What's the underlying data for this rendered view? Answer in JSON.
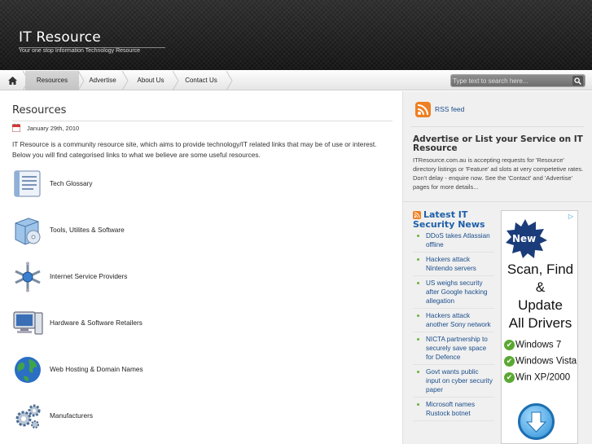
{
  "header": {
    "site_title": "IT Resource",
    "tagline": "Your one stop Information Technology Resource"
  },
  "nav": {
    "home_icon": "home-icon",
    "items": [
      {
        "label": "Resources",
        "active": true
      },
      {
        "label": "Advertise",
        "active": false
      },
      {
        "label": "About Us",
        "active": false
      },
      {
        "label": "Contact Us",
        "active": false
      }
    ],
    "search_placeholder": "Type text to search here...",
    "search_icon": "search-icon"
  },
  "main": {
    "title": "Resources",
    "date": "January 29th, 2010",
    "intro": "IT Resource is a community resource site, which aims to provide technology/IT related links that may be of use or interest. Below you will find categorised links to what we believe are some useful resources.",
    "categories": [
      {
        "label": "Tech Glossary",
        "icon": "glossary-icon"
      },
      {
        "label": "Tools, Utilites & Software",
        "icon": "software-box-icon"
      },
      {
        "label": "Internet Service Providers",
        "icon": "network-hub-icon"
      },
      {
        "label": "Hardware & Software Retailers",
        "icon": "computer-icon"
      },
      {
        "label": "Web Hosting & Domain Names",
        "icon": "globe-icon"
      },
      {
        "label": "Manufacturers",
        "icon": "gears-icon"
      }
    ]
  },
  "sidebar": {
    "rss_label": "RSS feed",
    "advertise_title": "Advertise or List your Service on IT Resource",
    "advertise_text": "ITResource.com.au is accepting requests for 'Resource' directory listings or 'Feature' ad slots at very competetive rates. Don't delay - enquire now. See the 'Contact' and 'Advertise' pages for more details...",
    "news_title": "Latest IT Security News",
    "news": [
      "DDoS takes Atlassian offline",
      "Hackers attack Nintendo servers",
      "US weighs security after Google hacking allegation",
      "Hackers attack another Sony network",
      "NICTA partnership to securely save space for Defence",
      "Govt wants public input on cyber security paper",
      "Microsoft names Rustock botnet"
    ],
    "ad": {
      "badge": "▷",
      "new_label": "New",
      "lines": [
        "Scan, Find",
        "&",
        "Update",
        "All Drivers"
      ],
      "os": [
        "Windows 7",
        "Windows Vista",
        "Win XP/2000"
      ]
    }
  },
  "colors": {
    "link": "#1a4d8a",
    "news_title": "#1e5fa8",
    "rss_orange": "#e5661c",
    "bullet_green": "#6bb13a"
  }
}
